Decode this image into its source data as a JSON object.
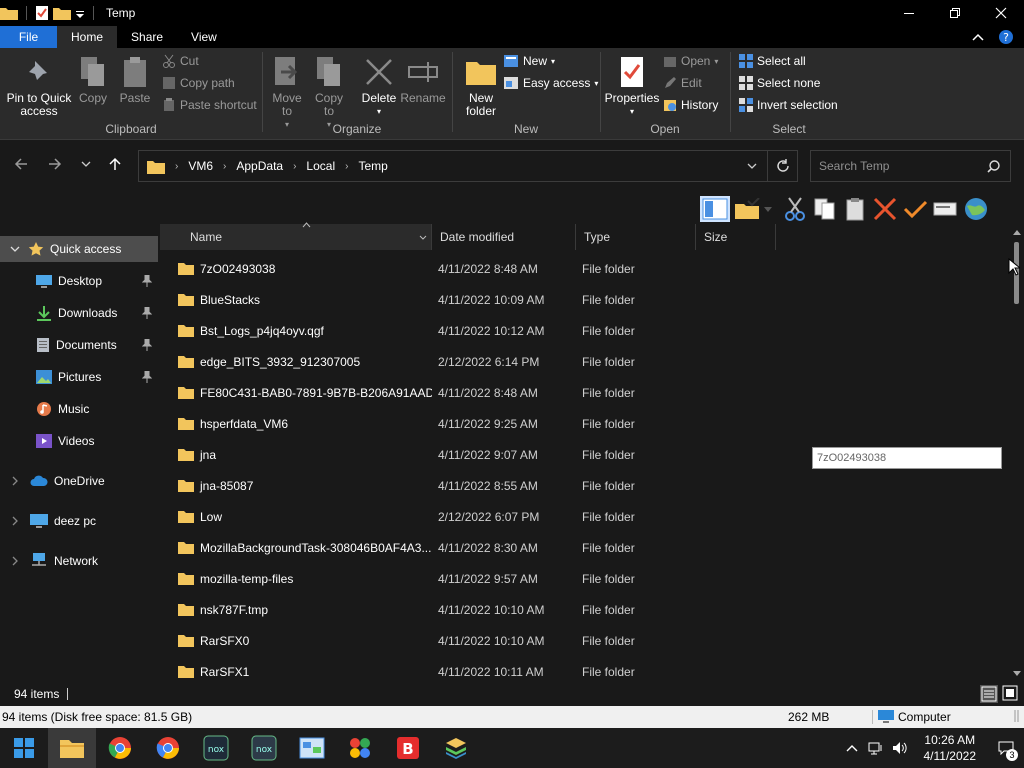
{
  "window": {
    "title": "Temp",
    "controls": [
      "minimize",
      "maximize",
      "close"
    ]
  },
  "ribbon_tabs": [
    {
      "label": "File"
    },
    {
      "label": "Home"
    },
    {
      "label": "Share"
    },
    {
      "label": "View"
    }
  ],
  "ribbon": {
    "clipboard": {
      "label": "Clipboard",
      "pin_label": "Pin to Quick access",
      "copy_label": "Copy",
      "paste_label": "Paste",
      "cut_label": "Cut",
      "copy_path_label": "Copy path",
      "paste_shortcut_label": "Paste shortcut"
    },
    "organize": {
      "label": "Organize",
      "move_to_label": "Move to",
      "copy_to_label": "Copy to",
      "delete_label": "Delete",
      "rename_label": "Rename"
    },
    "new": {
      "label": "New",
      "new_folder_label": "New folder",
      "new_item_label": "New",
      "easy_access_label": "Easy access"
    },
    "open": {
      "label": "Open",
      "properties_label": "Properties",
      "open_label": "Open",
      "edit_label": "Edit",
      "history_label": "History"
    },
    "select": {
      "label": "Select",
      "select_all_label": "Select all",
      "select_none_label": "Select none",
      "invert_label": "Invert selection"
    }
  },
  "address": {
    "crumbs": [
      "VM6",
      "AppData",
      "Local",
      "Temp"
    ],
    "search_placeholder": "Search Temp"
  },
  "nav": {
    "quick_access": "Quick access",
    "items": [
      {
        "label": "Desktop",
        "icon": "desktop-icon"
      },
      {
        "label": "Downloads",
        "icon": "download-icon"
      },
      {
        "label": "Documents",
        "icon": "documents-icon"
      },
      {
        "label": "Pictures",
        "icon": "pictures-icon"
      },
      {
        "label": "Music",
        "icon": "music-icon"
      },
      {
        "label": "Videos",
        "icon": "videos-icon"
      }
    ],
    "onedrive": "OneDrive",
    "this_pc": "deez pc",
    "network": "Network"
  },
  "columns": {
    "name": "Name",
    "date": "Date modified",
    "type": "Type",
    "size": "Size"
  },
  "files": [
    {
      "name": "7zO02493038",
      "date": "4/11/2022 8:48 AM",
      "type": "File folder"
    },
    {
      "name": "BlueStacks",
      "date": "4/11/2022 10:09 AM",
      "type": "File folder"
    },
    {
      "name": "Bst_Logs_p4jq4oyv.qgf",
      "date": "4/11/2022 10:12 AM",
      "type": "File folder"
    },
    {
      "name": "edge_BITS_3932_912307005",
      "date": "2/12/2022 6:14 PM",
      "type": "File folder"
    },
    {
      "name": "FE80C431-BAB0-7891-9B7B-B206A91AAD...",
      "date": "4/11/2022 8:48 AM",
      "type": "File folder"
    },
    {
      "name": "hsperfdata_VM6",
      "date": "4/11/2022 9:25 AM",
      "type": "File folder"
    },
    {
      "name": "jna",
      "date": "4/11/2022 9:07 AM",
      "type": "File folder"
    },
    {
      "name": "jna-85087",
      "date": "4/11/2022 8:55 AM",
      "type": "File folder"
    },
    {
      "name": "Low",
      "date": "2/12/2022 6:07 PM",
      "type": "File folder"
    },
    {
      "name": "MozillaBackgroundTask-308046B0AF4A3...",
      "date": "4/11/2022 8:30 AM",
      "type": "File folder"
    },
    {
      "name": "mozilla-temp-files",
      "date": "4/11/2022 9:57 AM",
      "type": "File folder"
    },
    {
      "name": "nsk787F.tmp",
      "date": "4/11/2022 10:10 AM",
      "type": "File folder"
    },
    {
      "name": "RarSFX0",
      "date": "4/11/2022 10:10 AM",
      "type": "File folder"
    },
    {
      "name": "RarSFX1",
      "date": "4/11/2022 10:11 AM",
      "type": "File folder"
    }
  ],
  "rename_value": "7zO02493038",
  "status": {
    "items": "94 items",
    "details": "94 items (Disk free space: 81.5 GB)",
    "size": "262 MB",
    "computer": "Computer"
  },
  "clock": {
    "time": "10:26 AM",
    "date": "4/11/2022"
  },
  "notification_count": "3",
  "colors": {
    "accent": "#1f6fd6",
    "folder": "#f2c55c",
    "background": "#191919"
  }
}
